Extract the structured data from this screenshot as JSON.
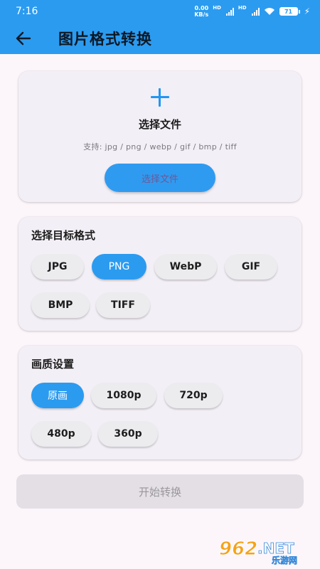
{
  "status": {
    "time": "7:16",
    "net_speed_value": "0.00",
    "net_speed_unit": "KB/s",
    "signal1_label": "HD",
    "signal2_label": "HD",
    "battery": "71"
  },
  "app_bar": {
    "title": "图片格式转换"
  },
  "upload": {
    "title": "选择文件",
    "hint": "支持: jpg / png / webp / gif / bmp / tiff",
    "button_label": "选择文件"
  },
  "format_section": {
    "title": "选择目标格式",
    "options": [
      "JPG",
      "PNG",
      "WebP",
      "GIF",
      "BMP",
      "TIFF"
    ],
    "selected": "PNG"
  },
  "quality_section": {
    "title": "画质设置",
    "options": [
      "原画",
      "1080p",
      "720p",
      "480p",
      "360p"
    ],
    "selected": "原画"
  },
  "start_button_label": "开始转换",
  "watermark": {
    "number": "962",
    "dot_net": ".NET",
    "subtitle": "乐游网"
  },
  "colors": {
    "primary": "#2b9bf0",
    "background": "#fcf6fb",
    "card": "#f3eff6"
  }
}
